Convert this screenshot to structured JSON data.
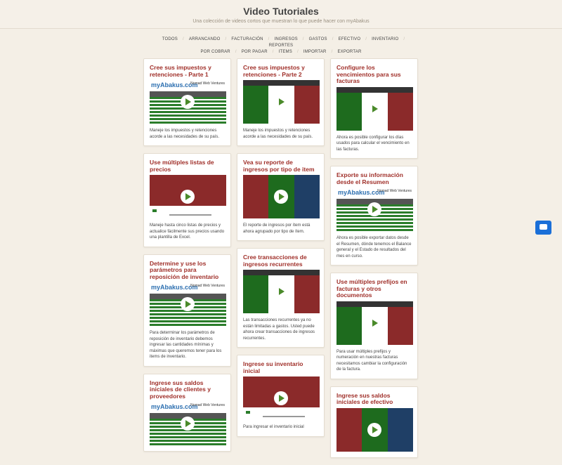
{
  "header": {
    "title": "Video Tutoriales",
    "subtitle": "Una colección de videos cortos que muestran lo que puede hacer con myAbakus"
  },
  "nav": {
    "row1": [
      "TODOS",
      "ARRANCANDO",
      "FACTURACIÓN",
      "INGRESOS",
      "GASTOS",
      "EFECTIVO",
      "INVENTARIO",
      "REPORTES"
    ],
    "row2": [
      "POR COBRAR",
      "POR PAGAR",
      "ITEMS",
      "IMPORTAR",
      "EXPORTAR"
    ]
  },
  "cards": [
    {
      "title": "Cree sus impuestos y retenciones - Parte 1",
      "desc": "Maneje los impuestos y retenciones acorde a las necesidades de su país.",
      "thumb": "report"
    },
    {
      "title": "Use múltiples listas de precios",
      "desc": "Maneje hasta cinco listas de precios y actualice fácilmente sus precios usando una plantilla de Excel.",
      "thumb": "red"
    },
    {
      "title": "Determine y use los parámetros para reposición de inventario",
      "desc": "Para determinar los parámetros de reposición de inventario debemos ingresar las cantidades mínimas y máximas que queremos tener para los items de inventario.",
      "thumb": "report"
    },
    {
      "title": "Ingrese sus saldos iniciales de clientes y proveedores",
      "desc": "",
      "thumb": "report"
    },
    {
      "title": "Cree sus impuestos y retenciones - Parte 2",
      "desc": "Maneje los impuestos y retenciones acorde a las necesidades de su país.",
      "thumb": "bars"
    },
    {
      "title": "Vea su reporte de ingresos por tipo de item",
      "desc": "El reporte de ingresos por ítem está ahora agrupado por tipo de ítem.",
      "thumb": "blocks"
    },
    {
      "title": "Cree transacciones de ingresos recurrentes",
      "desc": "Las transacciones recurrentes ya no están limitadas a gastos. Usted puede ahora crear transacciones de ingresos recurrentes.",
      "thumb": "bars"
    },
    {
      "title": "Ingrese su inventario inicial",
      "desc": "Para ingresar el inventario inicial",
      "thumb": "red"
    },
    {
      "title": "Configure los vencimientos para sus facturas",
      "desc": "Ahora es posible configurar los días usados para calcular el vencimiento en las facturas.",
      "thumb": "bars"
    },
    {
      "title": "Exporte su información desde el Resumen",
      "desc": "Ahora es posible exportar datos desde el Resumen, dónde tenemos el Balance general y el Estado de resultados del mes en curso.",
      "thumb": "report"
    },
    {
      "title": "Use múltiples prefijos en facturas y otros documentos",
      "desc": "Para usar múltiples prefijos y numeración en nuestras facturas necesitamos cambiar la configuración de la factura.",
      "thumb": "bars"
    },
    {
      "title": "Ingrese sus saldos iniciales de efectivo",
      "desc": "",
      "thumb": "blocks"
    }
  ],
  "thumb_text": {
    "logo": "myAbakus.com",
    "company": "Nomad Web Ventures"
  }
}
